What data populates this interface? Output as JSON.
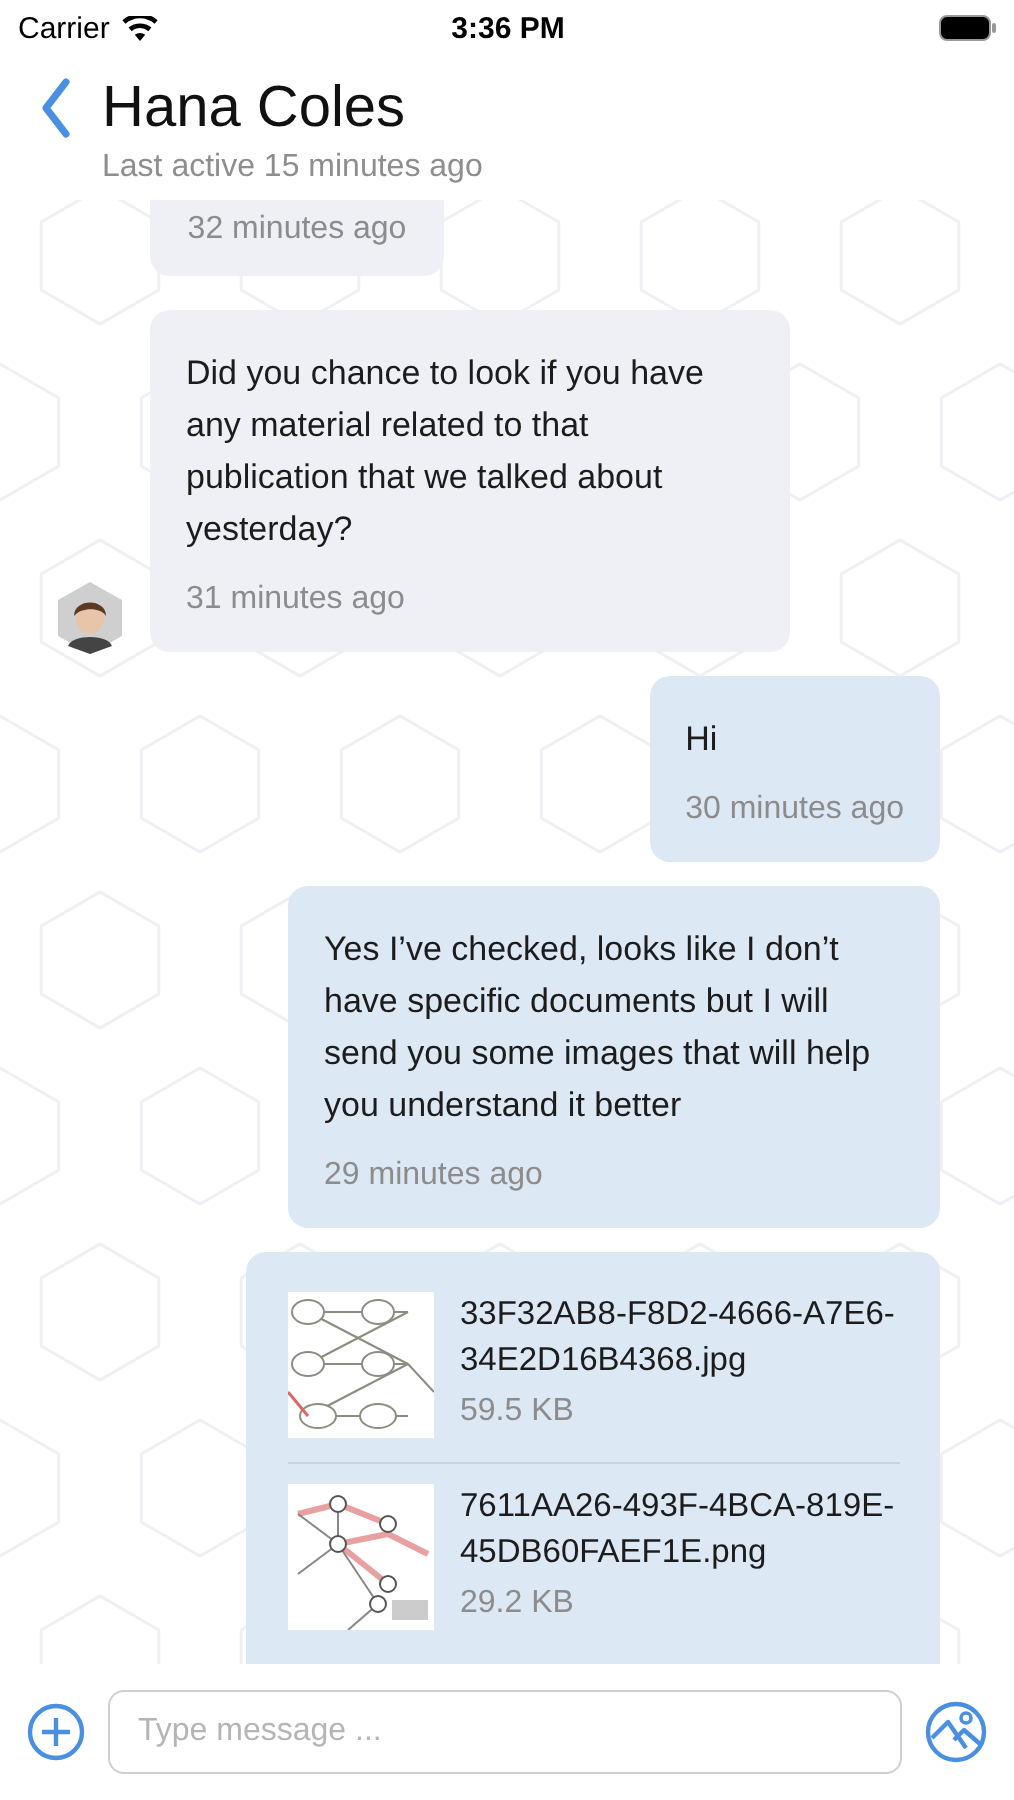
{
  "status_bar": {
    "carrier": "Carrier",
    "time": "3:36 PM"
  },
  "header": {
    "title": "Hana Coles",
    "subtitle": "Last active 15 minutes ago"
  },
  "messages": [
    {
      "kind": "text",
      "outgoing": false,
      "time": "32 minutes ago"
    },
    {
      "kind": "text",
      "outgoing": false,
      "text": "Did you chance to look if you have any material related to that publication that we talked about yesterday?",
      "time": "31 minutes ago"
    },
    {
      "kind": "text",
      "outgoing": true,
      "text": "Hi",
      "time": "30 minutes ago"
    },
    {
      "kind": "text",
      "outgoing": true,
      "text": "Yes I’ve checked, looks like I don’t have specific documents but I will send you some images that will help you understand it better",
      "time": "29 minutes ago"
    },
    {
      "kind": "files",
      "outgoing": true,
      "files": [
        {
          "name": "33F32AB8-F8D2-4666-A7E6-34E2D16B4368.jpg",
          "size": "59.5 KB"
        },
        {
          "name": "7611AA26-493F-4BCA-819E-45DB60FAEF1E.png",
          "size": "29.2 KB"
        }
      ]
    }
  ],
  "composer": {
    "placeholder": "Type message ..."
  }
}
